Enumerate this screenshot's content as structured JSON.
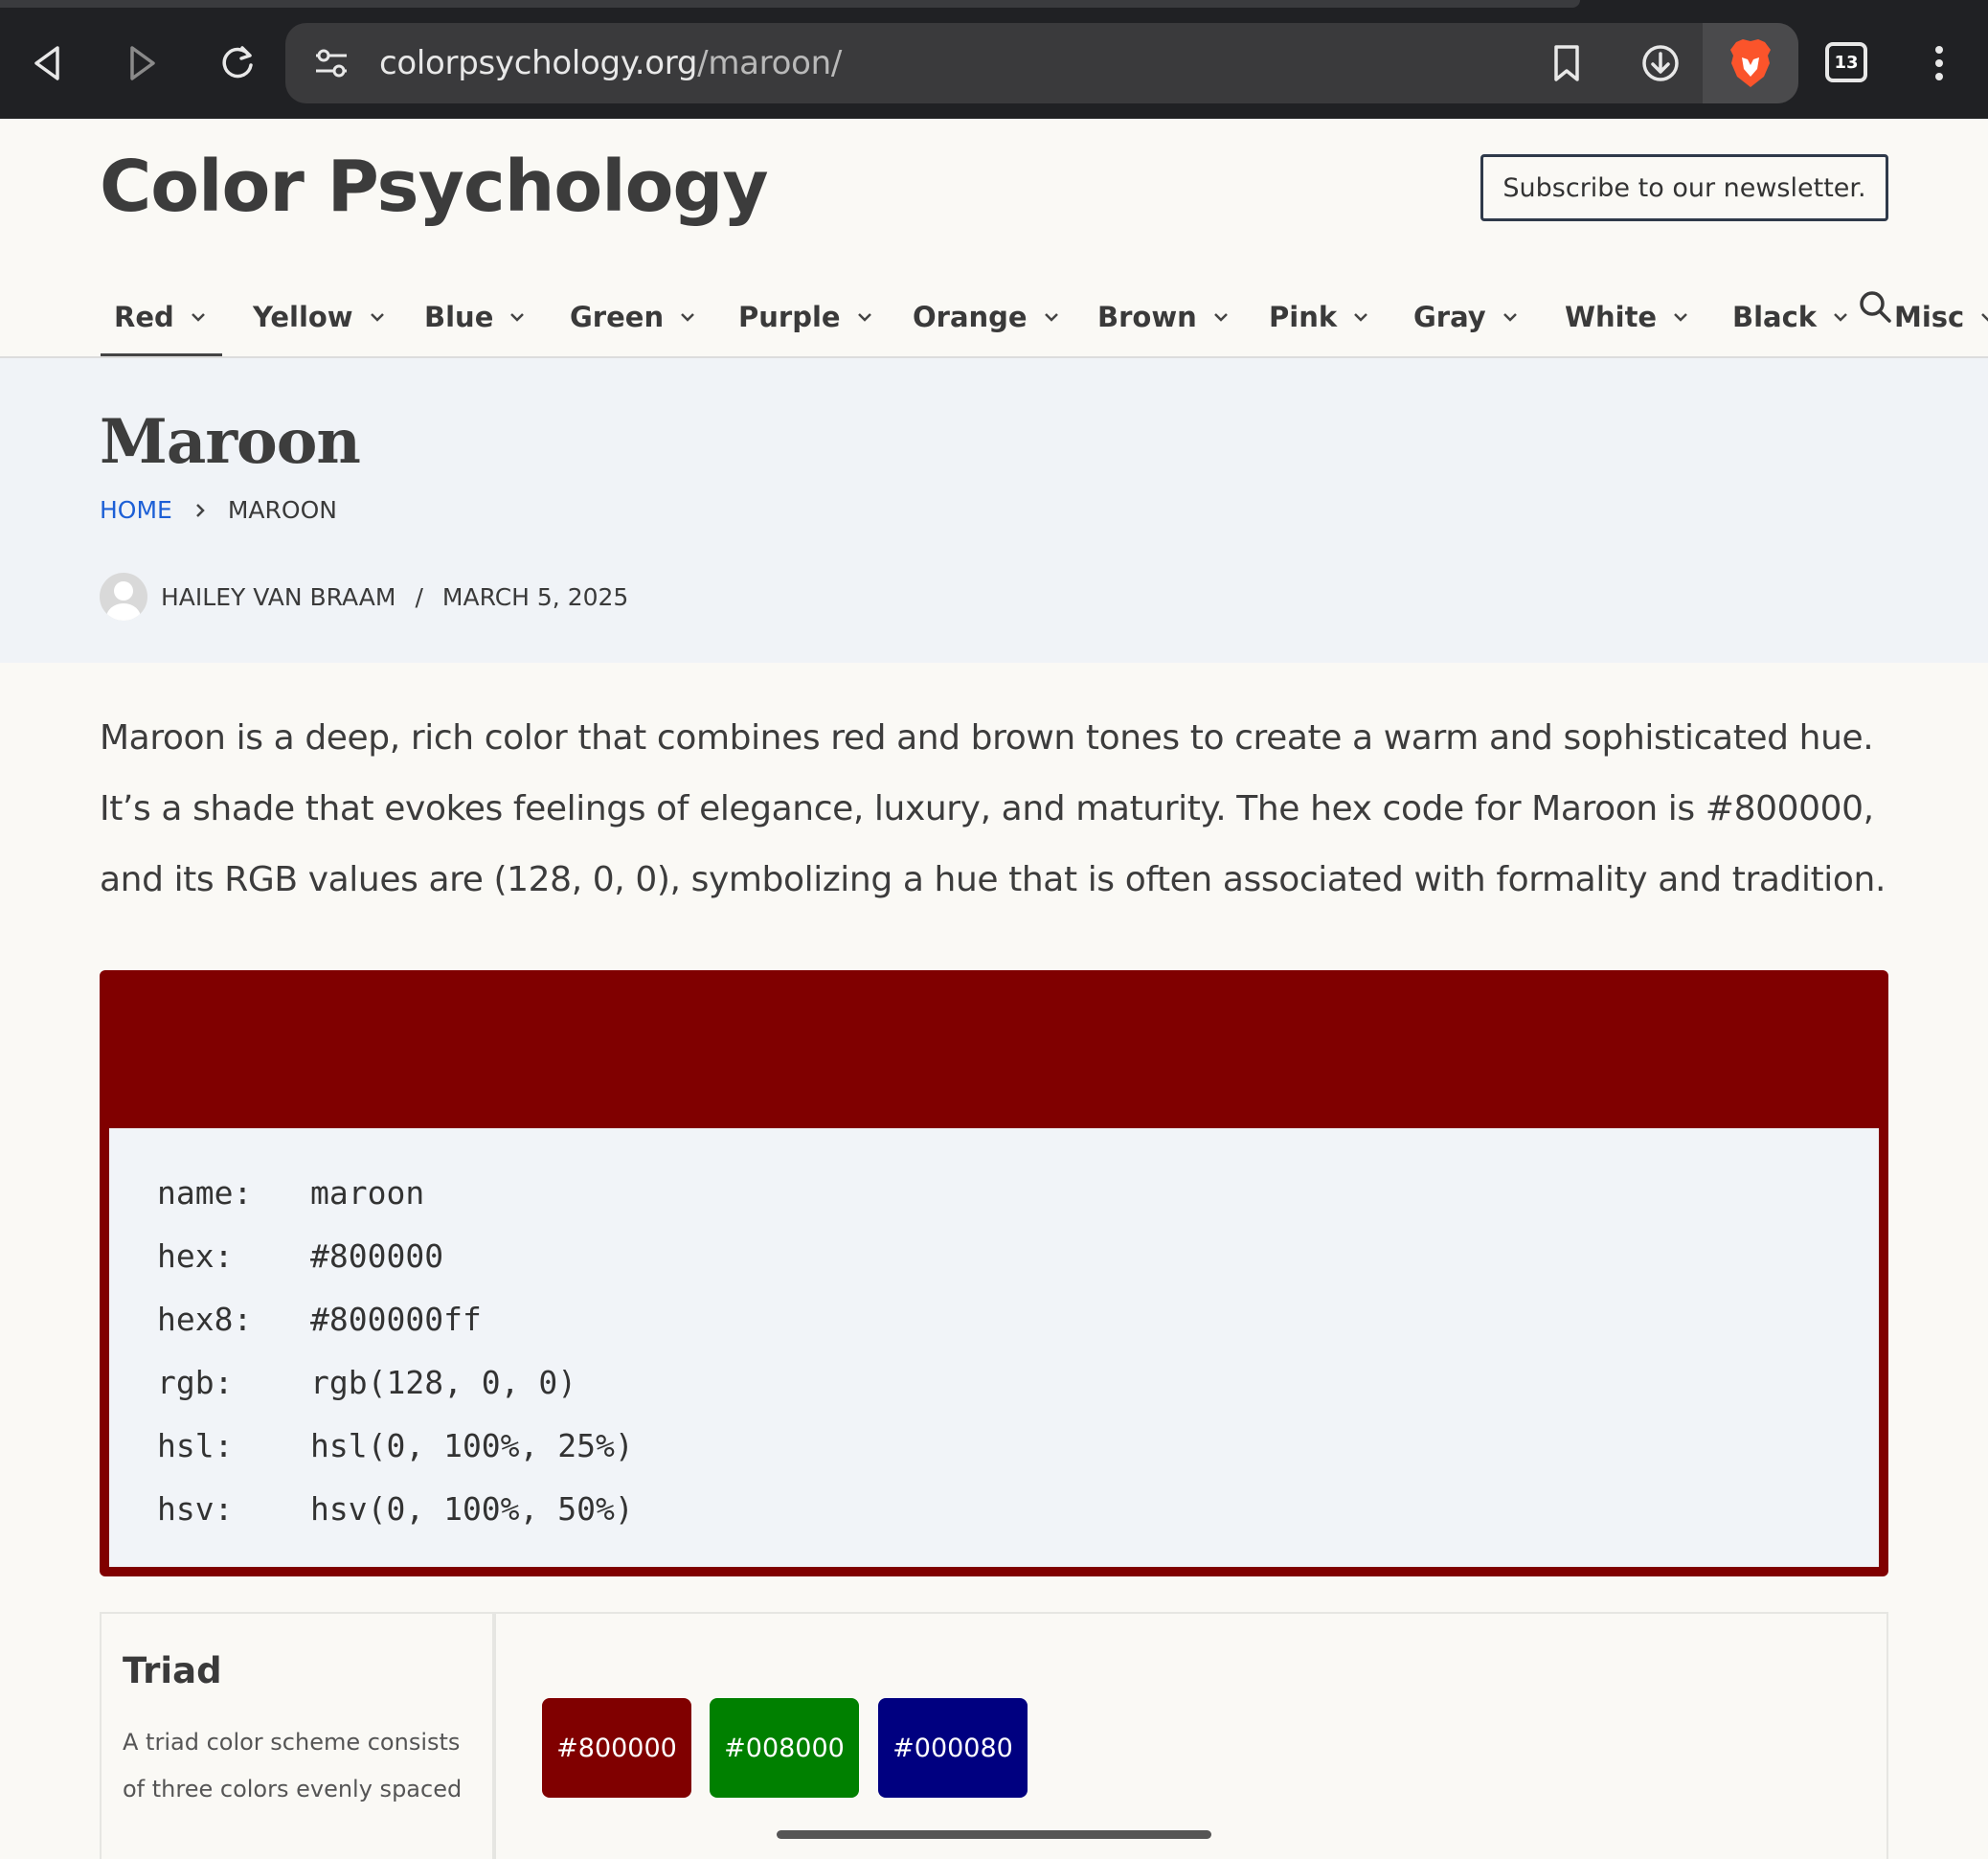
{
  "browser": {
    "url_host": "colorpsychology.org",
    "url_path": "/maroon/",
    "tab_count": "13"
  },
  "site": {
    "title": "Color Psychology",
    "subscribe_label": "Subscribe to our newsletter."
  },
  "nav": {
    "items": [
      {
        "label": "Red"
      },
      {
        "label": "Yellow"
      },
      {
        "label": "Blue"
      },
      {
        "label": "Green"
      },
      {
        "label": "Purple"
      },
      {
        "label": "Orange"
      },
      {
        "label": "Brown"
      },
      {
        "label": "Pink"
      },
      {
        "label": "Gray"
      },
      {
        "label": "White"
      },
      {
        "label": "Black"
      },
      {
        "label": "Misc"
      }
    ]
  },
  "page": {
    "title": "Maroon",
    "breadcrumb_home": "HOME",
    "breadcrumb_current": "MAROON",
    "author": "HAILEY VAN BRAAM",
    "meta_separator": "/",
    "date": "MARCH 5, 2025",
    "intro": "Maroon is a deep, rich color that combines red and brown tones to create a warm and sophisticated hue. It’s a shade that evokes feelings of elegance, luxury, and maturity. The hex code for Maroon is #800000, and its RGB values are (128, 0, 0), symbolizing a hue that is often associated with formality and tradition."
  },
  "color_card": {
    "swatch_color": "#800000",
    "specs": [
      {
        "key": "name:",
        "value": "maroon"
      },
      {
        "key": "hex:",
        "value": "#800000"
      },
      {
        "key": "hex8:",
        "value": "#800000ff"
      },
      {
        "key": "rgb:",
        "value": "rgb(128, 0, 0)"
      },
      {
        "key": "hsl:",
        "value": "hsl(0, 100%, 25%)"
      },
      {
        "key": "hsv:",
        "value": "hsv(0, 100%, 50%)"
      }
    ]
  },
  "triad": {
    "title": "Triad",
    "description": "A triad color scheme consists of three colors evenly spaced",
    "swatches": [
      {
        "label": "#800000",
        "color": "#800000"
      },
      {
        "label": "#008000",
        "color": "#008000"
      },
      {
        "label": "#000080",
        "color": "#000080"
      }
    ]
  },
  "icons": {
    "back": "back-arrow-icon",
    "forward": "forward-arrow-icon",
    "reload": "reload-icon",
    "site_settings": "tune-icon",
    "bookmark": "bookmark-icon",
    "download": "download-icon",
    "brave": "brave-lion-icon",
    "tabs": "tab-switcher-icon",
    "menu": "kebab-menu-icon",
    "search": "search-icon"
  }
}
